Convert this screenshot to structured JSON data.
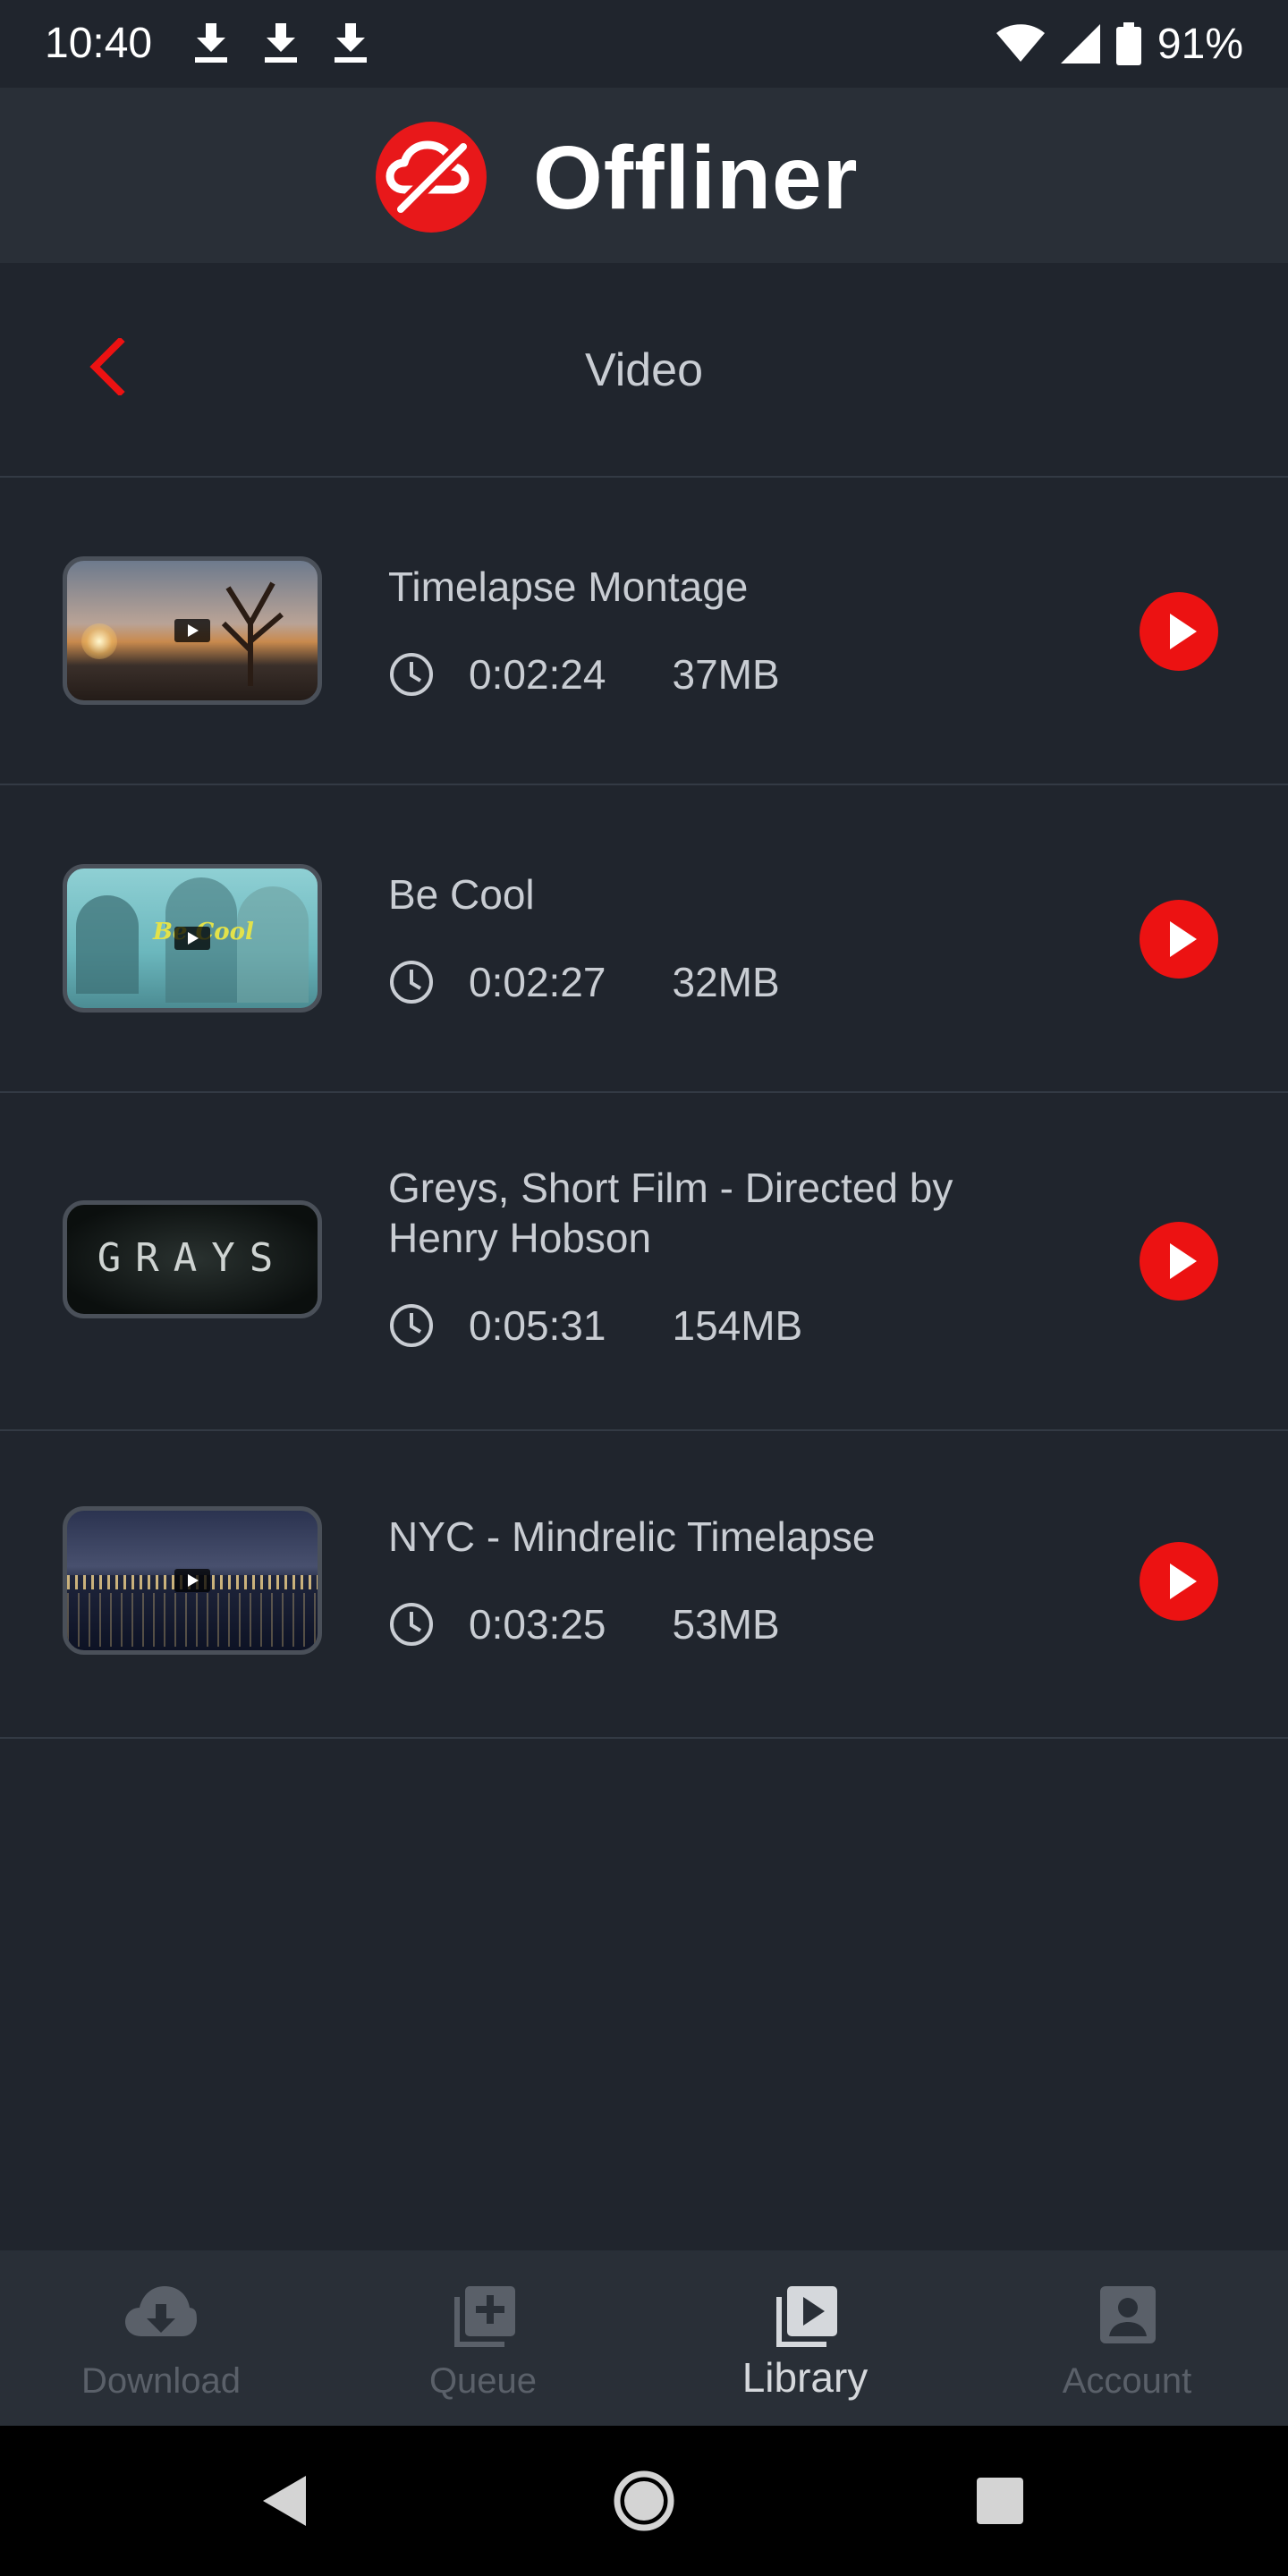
{
  "status_bar": {
    "time": "10:40",
    "battery_percent": "91%",
    "icons": [
      "download-icon",
      "download-icon",
      "download-icon",
      "wifi-icon",
      "signal-icon",
      "battery-icon"
    ]
  },
  "header": {
    "brand": "Offliner",
    "logo_icon": "offliner-logo-icon"
  },
  "page": {
    "title": "Video",
    "back_icon": "back-arrow-icon"
  },
  "videos": [
    {
      "title": "Timelapse Montage",
      "duration": "0:02:24",
      "size": "37MB"
    },
    {
      "title": "Be Cool",
      "duration": "0:02:27",
      "size": "32MB"
    },
    {
      "title": "Greys, Short Film - Directed by Henry Hobson",
      "duration": "0:05:31",
      "size": "154MB"
    },
    {
      "title": "NYC - Mindrelic Timelapse",
      "duration": "0:03:25",
      "size": "53MB"
    }
  ],
  "bottom_nav": {
    "items": [
      {
        "label": "Download",
        "icon": "cloud-download-icon",
        "active": false
      },
      {
        "label": "Queue",
        "icon": "queue-add-icon",
        "active": false
      },
      {
        "label": "Library",
        "icon": "library-play-icon",
        "active": true
      },
      {
        "label": "Account",
        "icon": "account-icon",
        "active": false
      }
    ]
  },
  "colors": {
    "accent": "#ec1212",
    "background": "#20252d",
    "header": "#292f37"
  }
}
